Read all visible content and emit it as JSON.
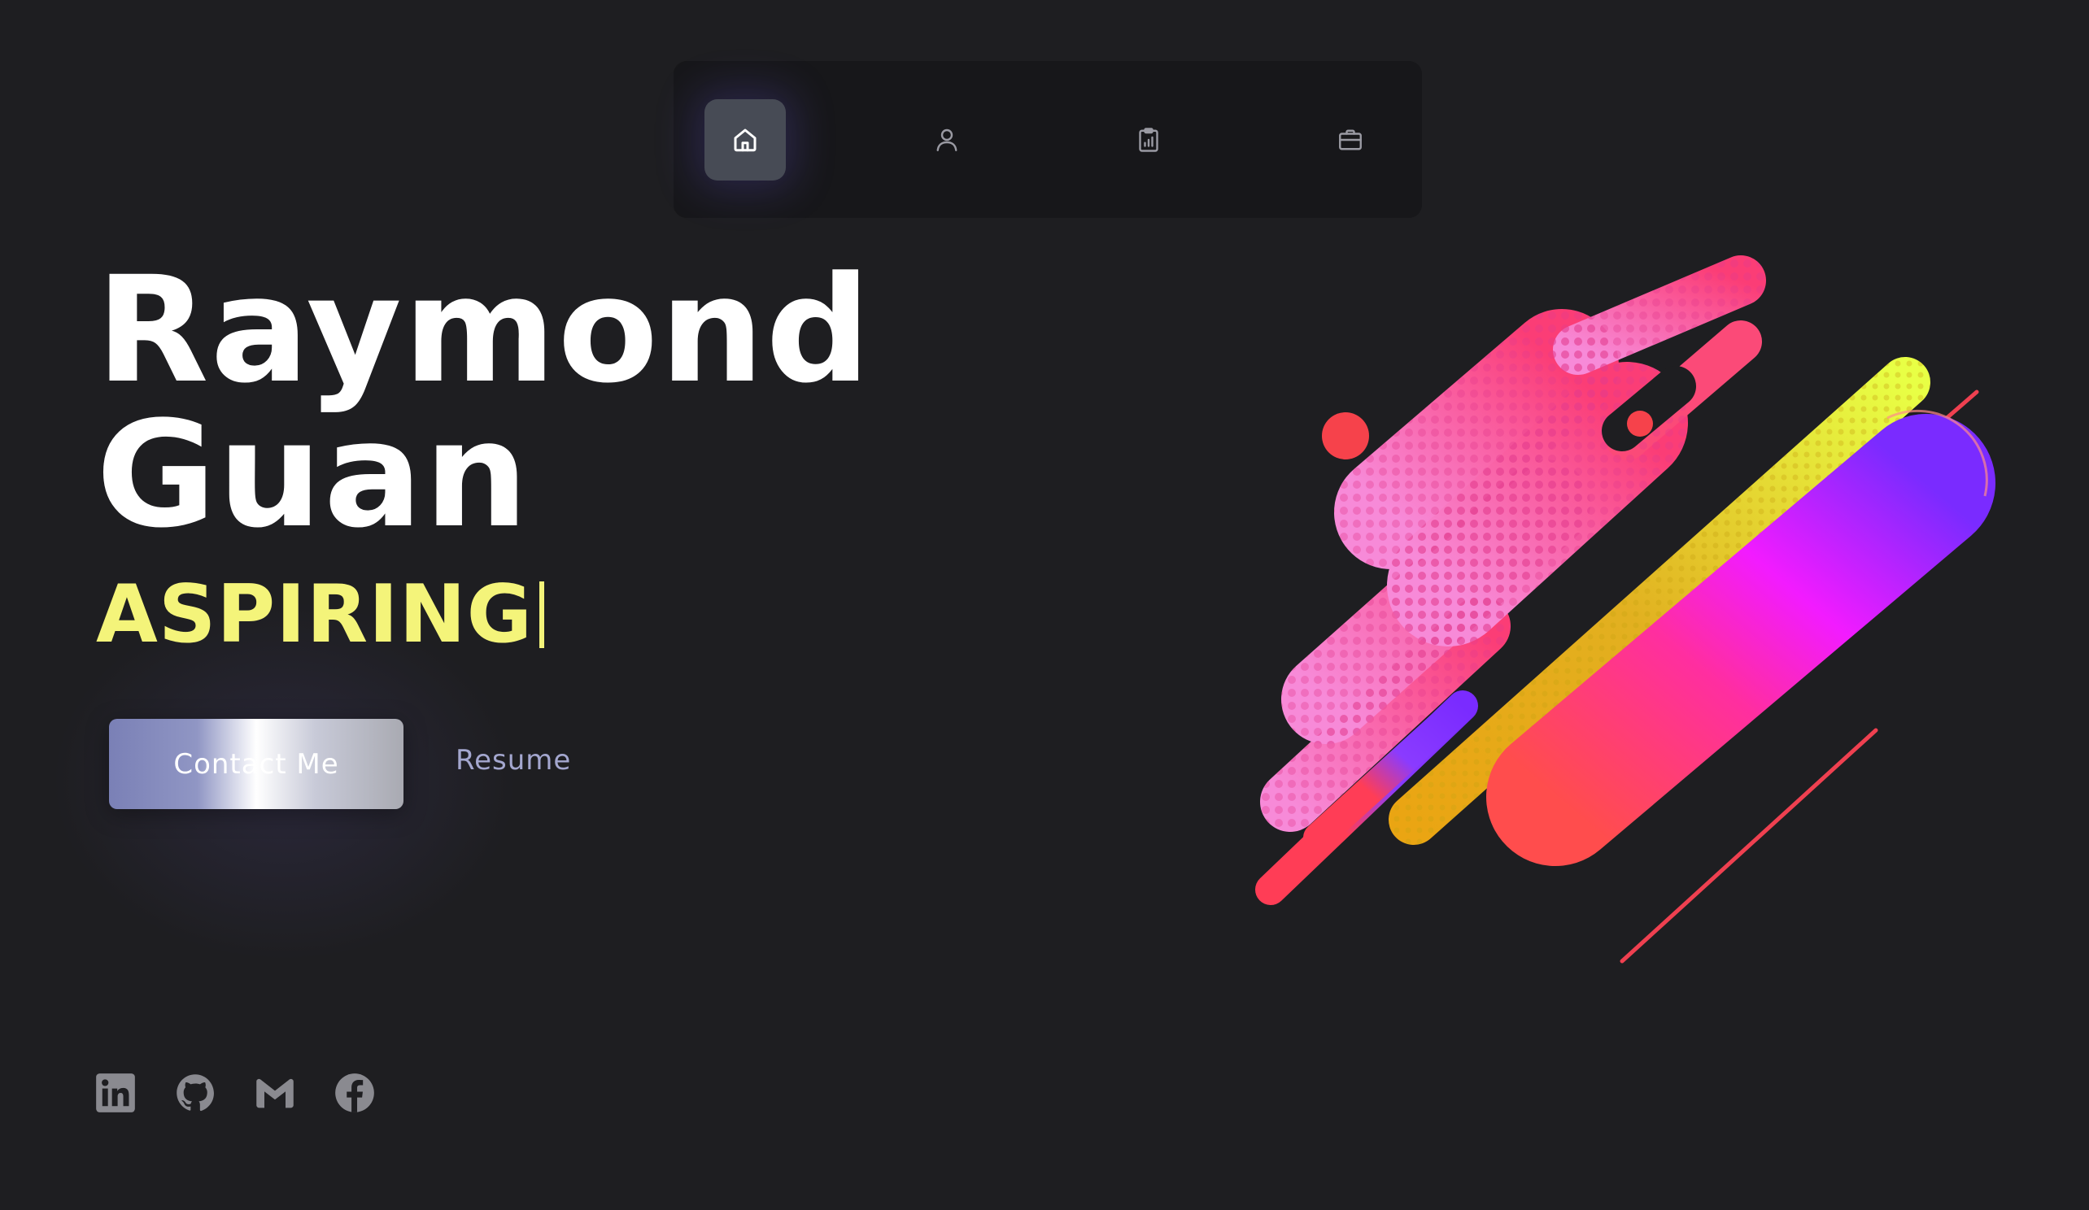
{
  "nav": {
    "items": [
      {
        "icon": "home-icon",
        "active": true
      },
      {
        "icon": "user-icon",
        "active": false
      },
      {
        "icon": "clipboard-chart-icon",
        "active": false
      },
      {
        "icon": "briefcase-icon",
        "active": false
      }
    ]
  },
  "hero": {
    "first_name": "Raymond",
    "last_name": "Guan",
    "role_typed": "ASPIRING",
    "contact_label": "Contact Me",
    "resume_label": "Resume"
  },
  "socials": [
    {
      "icon": "linkedin-icon"
    },
    {
      "icon": "github-icon"
    },
    {
      "icon": "gmail-icon"
    },
    {
      "icon": "facebook-icon"
    }
  ],
  "colors": {
    "background": "#1e1e21",
    "nav_background": "#17171a",
    "accent_yellow": "#f4f47a",
    "resume_text": "#a4a7cf",
    "icon_gray": "#8a8a90"
  }
}
